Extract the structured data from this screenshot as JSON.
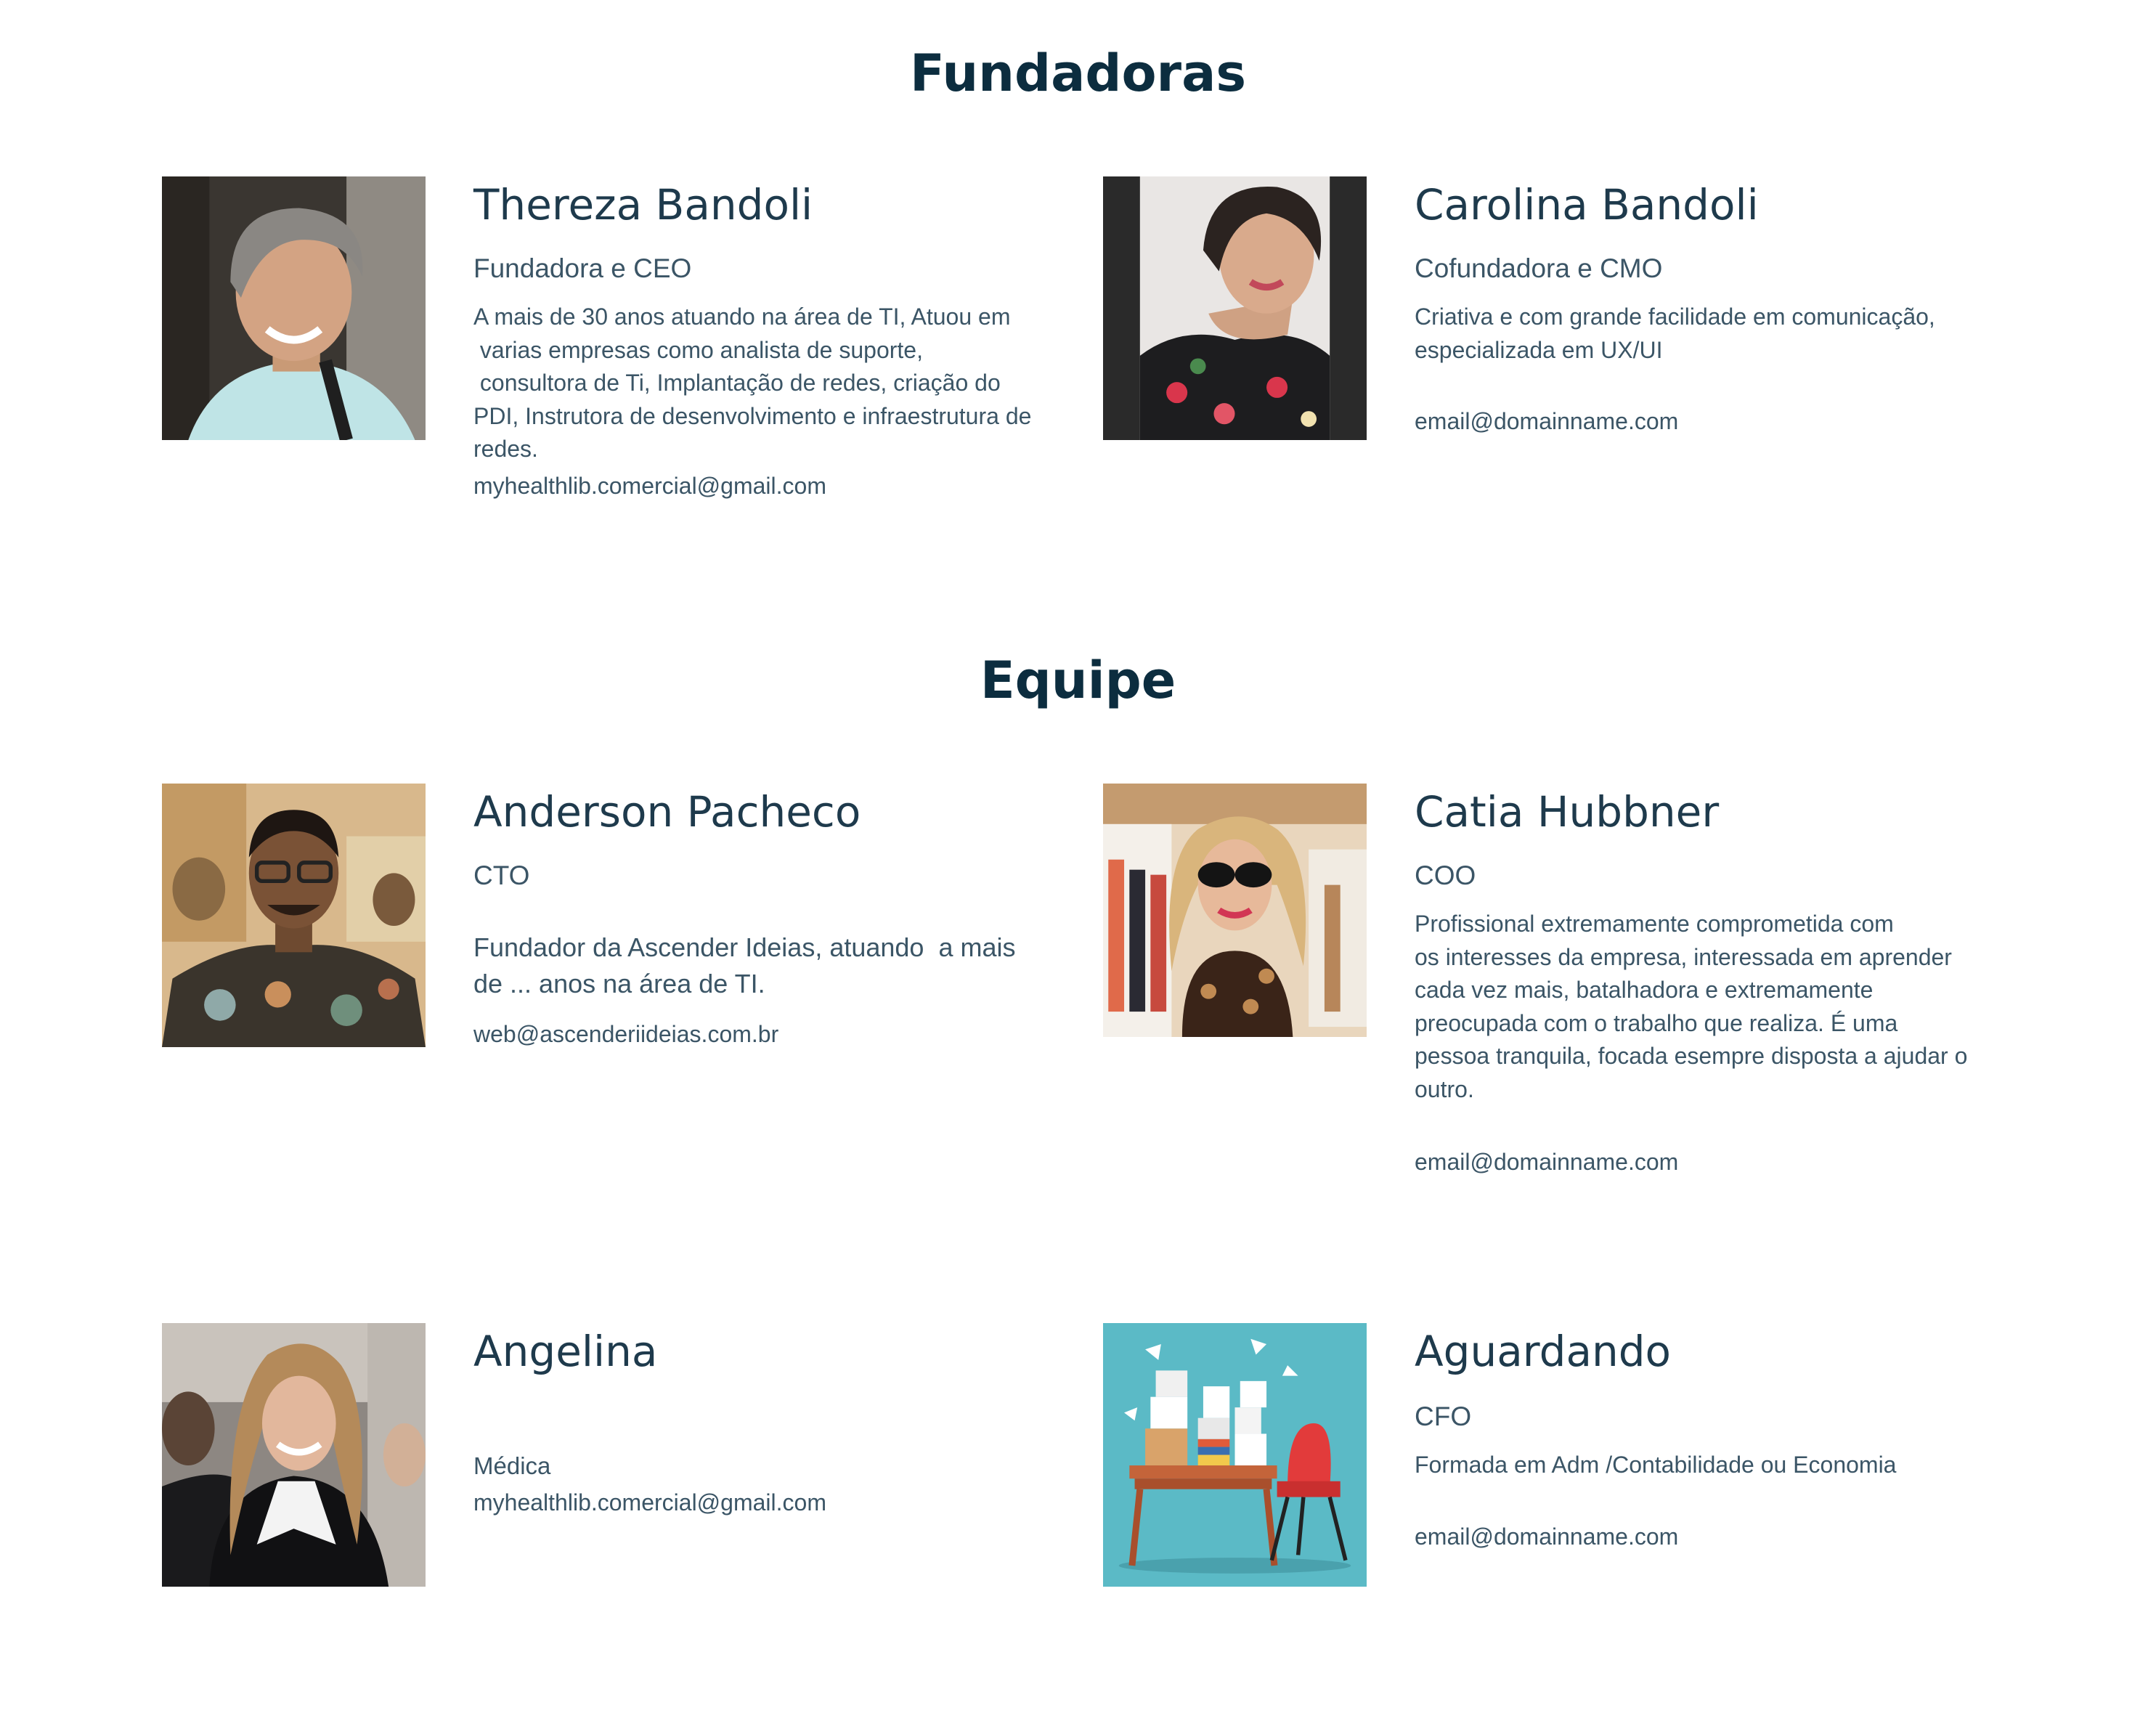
{
  "founders_section": {
    "title": "Fundadoras",
    "members": [
      {
        "name": "Thereza Bandoli",
        "role": "Fundadora e CEO",
        "description_lines": [
          "A mais de 30 anos atuando na área de TI,  Atuou em",
          " varias empresas como analista de suporte,",
          " consultora de Ti, Implantação de redes, criação do",
          "PDI, Instrutora de desenvolvimento e infraestrutura de",
          "redes."
        ],
        "email": "myhealthlib.comercial@gmail.com"
      },
      {
        "name": "Carolina Bandoli",
        "role": "Cofundadora e CMO",
        "description_lines": [
          "Criativa e com grande facilidade em comunicação,",
          "especializada em UX/UI"
        ],
        "email": "email@domainname.com"
      }
    ]
  },
  "team_section": {
    "title": "Equipe",
    "members": [
      {
        "name": "Anderson Pacheco",
        "role": "CTO",
        "description_lines": [
          "Fundador da Ascender Ideias, atuando  a mais",
          "de ... anos na área de TI."
        ],
        "email": "web@ascenderiideias.com.br"
      },
      {
        "name": "Catia Hubbner",
        "role": "COO",
        "description_lines": [
          "Profissional extremamente comprometida com",
          "os interesses da empresa, interessada em aprender",
          "cada vez mais, batalhadora e extremamente",
          "preocupada com o trabalho que realiza. É uma",
          "pessoa tranquila, focada esempre disposta a ajudar o",
          "outro."
        ],
        "email": "email@domainname.com"
      },
      {
        "name": "Angelina",
        "role": "Médica",
        "email": "myhealthlib.comercial@gmail.com"
      },
      {
        "name": "Aguardando",
        "role": "CFO",
        "description_lines": [
          "Formada em Adm /Contabilidade ou Economia"
        ],
        "email": "email@domainname.com"
      }
    ]
  }
}
